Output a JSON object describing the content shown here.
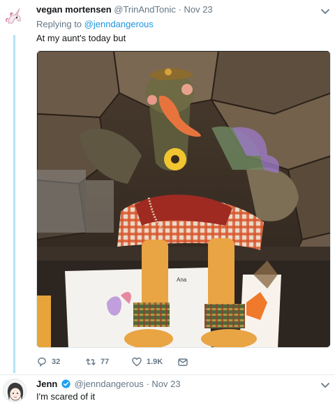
{
  "tweet1": {
    "name": "vegan mortensen",
    "handle": "@TrinAndTonic",
    "separator": "·",
    "date": "Nov 23",
    "replying_prefix": "Replying to",
    "replying_mention": "@jenndangerous",
    "text": "At my aunt's today but",
    "image_label": "Ana",
    "actions": {
      "replies": "32",
      "retweets": "77",
      "likes": "1.9K"
    }
  },
  "tweet2": {
    "name": "Jenn",
    "handle": "@jenndangerous",
    "separator": "·",
    "date": "Nov 23",
    "text": "I'm scared of it"
  },
  "colors": {
    "accent": "#1b95e0",
    "muted": "#657786",
    "thread_line": "#b6e2f7",
    "verified": "#1da1f2"
  },
  "icons": [
    "unicorn-avatar-icon",
    "chevron-down-icon",
    "reply-icon",
    "retweet-icon",
    "like-icon",
    "direct-message-icon",
    "verified-badge-icon",
    "cartoon-avatar-icon"
  ]
}
